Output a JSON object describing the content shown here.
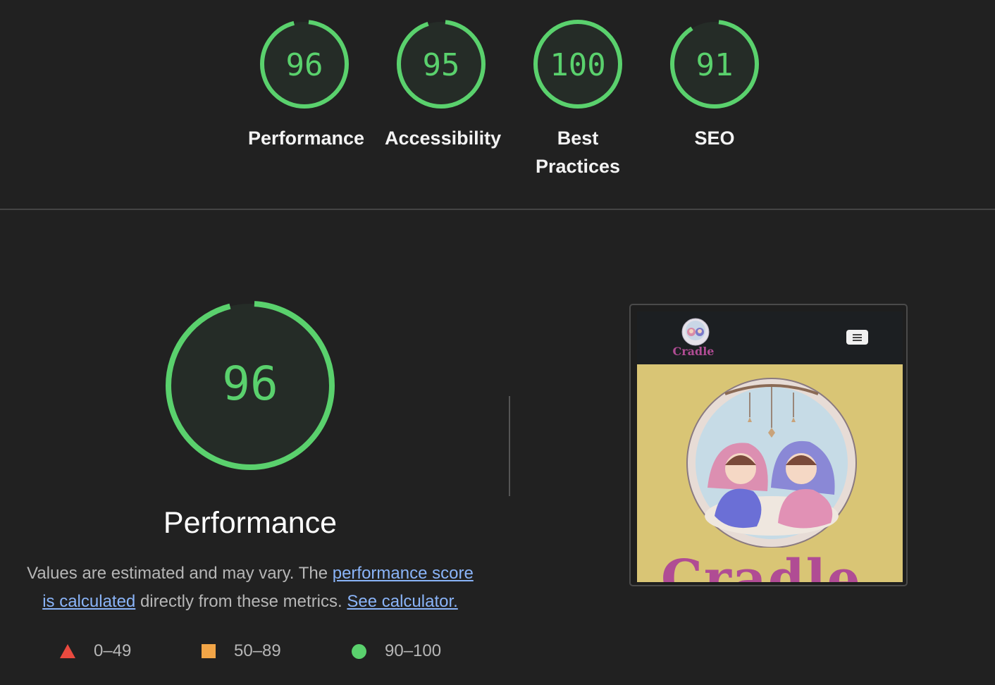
{
  "categories": [
    {
      "score": "96",
      "value": 96,
      "label": "Performance"
    },
    {
      "score": "95",
      "value": 95,
      "label": "Accessibility"
    },
    {
      "score": "100",
      "value": 100,
      "label": "Best Practices"
    },
    {
      "score": "91",
      "value": 91,
      "label": "SEO"
    }
  ],
  "main": {
    "score": "96",
    "value": 96,
    "title": "Performance",
    "desc_prefix": "Values are estimated and may vary. The ",
    "desc_link": "performance score is calculated",
    "desc_middle": " directly from these metrics. ",
    "desc_calc_link": "See calculator."
  },
  "legend": [
    {
      "icon": "triangle-icon",
      "label": "0–49",
      "color": "#e94a3f"
    },
    {
      "icon": "square-icon",
      "label": "50–89",
      "color": "#f2a547"
    },
    {
      "icon": "circle-icon",
      "label": "90–100",
      "color": "#5ad16d"
    }
  ],
  "screenshot": {
    "brand": "Cradle",
    "hero_text": "Cradle"
  },
  "colors": {
    "pass": "#5ad16d",
    "average": "#f2a547",
    "fail": "#e94a3f",
    "link": "#8ab4f8",
    "background": "#212121"
  }
}
